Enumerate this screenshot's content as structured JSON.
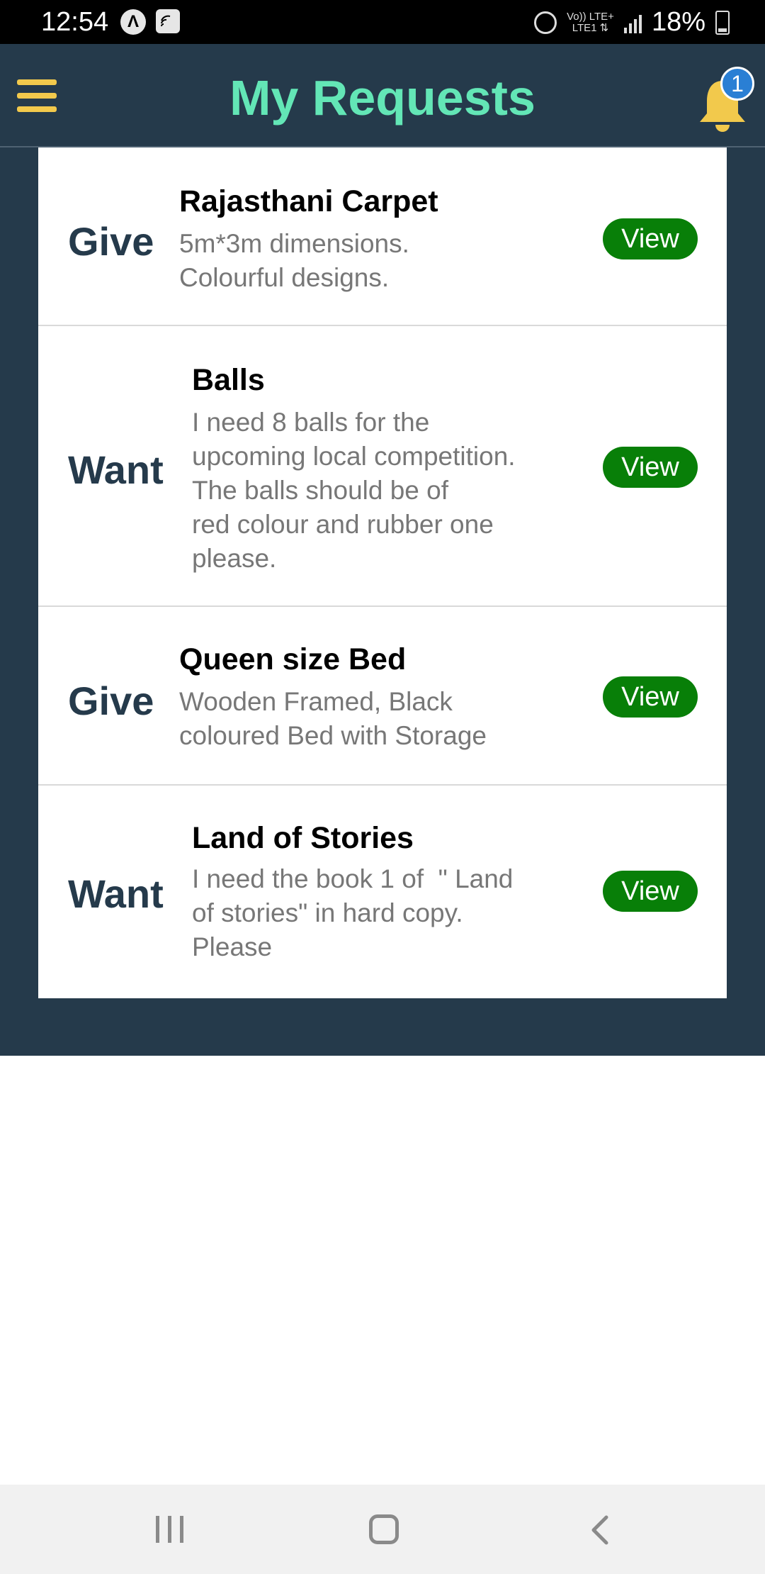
{
  "status_bar": {
    "time": "12:54",
    "network_top": "Vo)) LTE+",
    "network_bottom": "LTE1 ⇅",
    "battery": "18%"
  },
  "app_bar": {
    "title": "My Requests",
    "notification_count": "1",
    "colors": {
      "background": "#253a4b",
      "title": "#63e6b6",
      "menu": "#f2c94c",
      "bell": "#f2c94c",
      "badge": "#2a7fd4"
    }
  },
  "requests": [
    {
      "type": "Give",
      "title": "Rajasthani Carpet",
      "description": "5m*3m dimensions.\nColourful designs.",
      "action": "View"
    },
    {
      "type": "Want",
      "title": "Balls",
      "description": "I need 8 balls for the\nupcoming local competition.\nThe balls should be of\nred colour and rubber one\nplease.",
      "action": "View"
    },
    {
      "type": "Give",
      "title": "Queen size Bed",
      "description": "Wooden Framed, Black\ncoloured Bed with Storage",
      "action": "View"
    },
    {
      "type": "Want",
      "title": "Land of Stories",
      "description": "I need the book 1 of  \" Land\nof stories\" in hard copy.\nPlease",
      "action": "View"
    }
  ],
  "colors": {
    "view_button": "#087f08",
    "type_label": "#253a4b"
  },
  "nav_bar": {
    "icons": [
      "recents-icon",
      "home-icon",
      "back-icon"
    ]
  }
}
